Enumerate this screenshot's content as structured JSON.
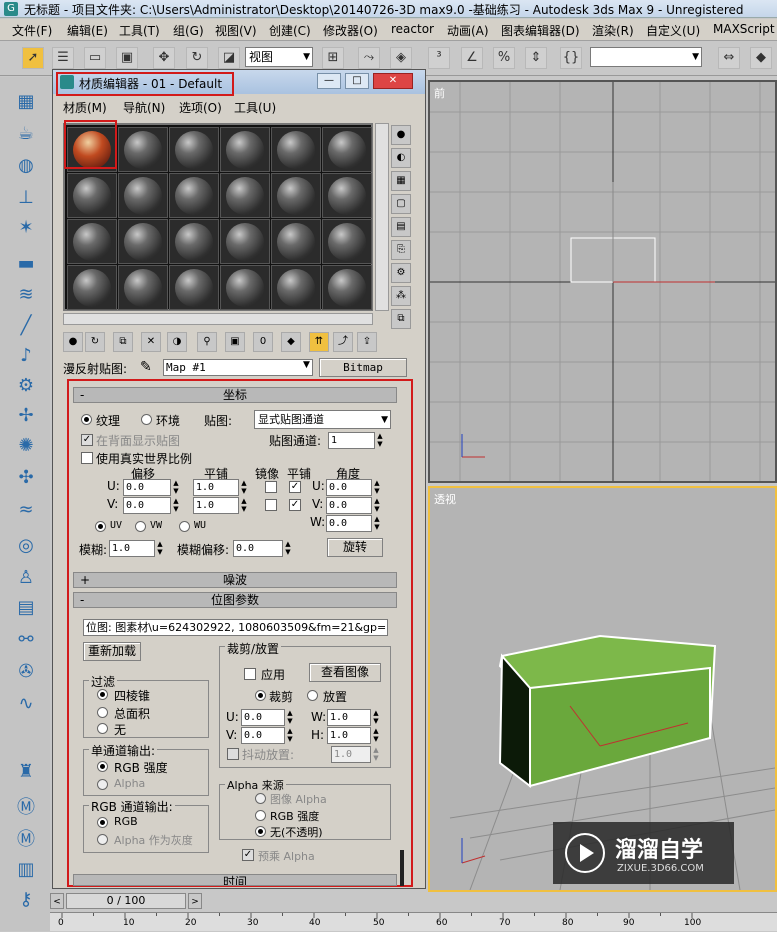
{
  "app": {
    "title": "无标题     - 项目文件夹: C:\\Users\\Administrator\\Desktop\\20140726-3D max9.0 -基础练习     - Autodesk 3ds Max 9   - Unregistered"
  },
  "menu": [
    "文件(F)",
    "编辑(E)",
    "工具(T)",
    "组(G)",
    "视图(V)",
    "创建(C)",
    "修改器(O)",
    "reactor",
    "动画(A)",
    "图表编辑器(D)",
    "渲染(R)",
    "自定义(U)",
    "MAXScript"
  ],
  "toolbar": {
    "view_select": "视图"
  },
  "viewports": {
    "front_label": "前",
    "persp_label": "透视"
  },
  "material_editor": {
    "title": "材质编辑器 - 01 - Default",
    "menu": [
      "材质(M)",
      "导航(N)",
      "选项(O)",
      "工具(U)"
    ],
    "diffuse_label": "漫反射贴图:",
    "map_name": "Map #1",
    "map_type": "Bitmap",
    "coords": {
      "rollout": "坐标",
      "texture": "纹理",
      "environ": "环境",
      "mapping_label": "贴图:",
      "mapping_value": "显式贴图通道",
      "show_back": "在背面显示贴图",
      "map_channel_label": "贴图通道:",
      "map_channel": "1",
      "real_world": "使用真实世界比例",
      "offset": "偏移",
      "tiling": "平铺",
      "mirror": "镜像",
      "tile": "平铺",
      "angle": "角度",
      "u": "U:",
      "v": "V:",
      "w": "W:",
      "u_offset": "0.0",
      "v_offset": "0.0",
      "u_tiling": "1.0",
      "v_tiling": "1.0",
      "u_angle": "0.0",
      "v_angle": "0.0",
      "w_angle": "0.0",
      "uv": "UV",
      "vw": "VW",
      "wu": "WU",
      "blur": "模糊:",
      "blur_val": "1.0",
      "blur_offset": "模糊偏移:",
      "blur_offset_val": "0.0",
      "rotate": "旋转"
    },
    "noise": {
      "rollout": "噪波"
    },
    "bitmap_params": {
      "rollout": "位图参数",
      "path": "位图: 图素材\\u=624302922, 1080603509&fm=21&gp=0.jpg",
      "reload": "重新加载",
      "crop_title": "裁剪/放置",
      "apply": "应用",
      "view_image": "查看图像",
      "crop": "裁剪",
      "place": "放置",
      "cu": "0.0",
      "cv": "0.0",
      "cw": "1.0",
      "ch": "1.0",
      "jitter": "抖动放置:",
      "jitter_val": "1.0",
      "filter_title": "过滤",
      "pyramidal": "四棱锥",
      "summed": "总面积",
      "none": "无",
      "mono_title": "单通道输出:",
      "rgb_intensity": "RGB 强度",
      "alpha": "Alpha",
      "rgb_title": "RGB 通道输出:",
      "rgb": "RGB",
      "alpha_gray": "Alpha 作为灰度",
      "alpha_src_title": "Alpha 来源",
      "image_alpha": "图像 Alpha",
      "rgb_int2": "RGB 强度",
      "opaque": "无(不透明)",
      "premult": "预乘 Alpha"
    },
    "time_rollout": "时间"
  },
  "timeline": {
    "frame": "0 / 100"
  },
  "ruler_ticks": [
    "0",
    "10",
    "20",
    "30",
    "40",
    "50",
    "60",
    "70",
    "80",
    "90",
    "100"
  ],
  "watermark": {
    "title": "溜溜自学",
    "url": "ZIXUE.3D66.COM"
  }
}
